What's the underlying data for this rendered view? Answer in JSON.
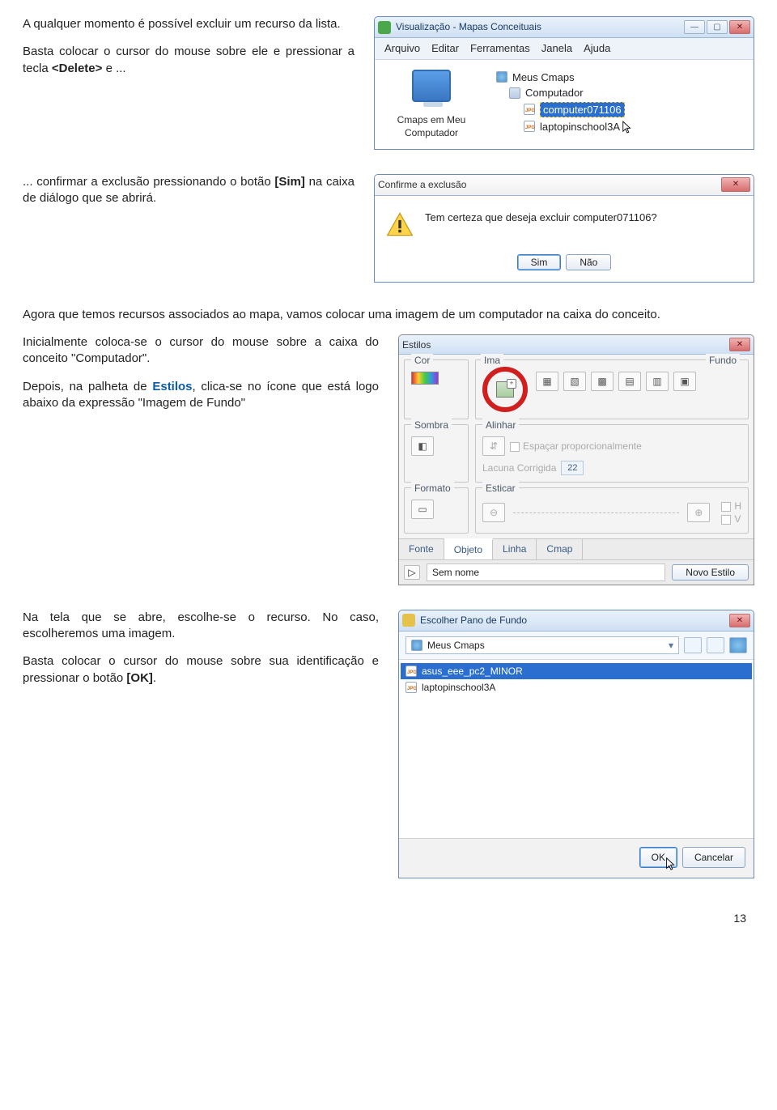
{
  "para1a": "A qualquer momento é possível excluir um recurso da lista.",
  "para1b_pre": "Basta colocar o cursor do mouse sobre ele e pressionar a tecla ",
  "para1b_key": "<Delete>",
  "para1b_post": " e ...",
  "para2_pre": "... confirmar a exclusão pressionando o botão ",
  "para2_btn": "[Sim]",
  "para2_post": " na caixa de diálogo que se abrirá.",
  "para3": "Agora que temos recursos associados ao mapa, vamos colocar uma imagem de um computador na caixa do conceito.",
  "para4": "Inicialmente coloca-se o cursor do mouse sobre a caixa do conceito \"Computador\".",
  "para5_pre": "Depois, na palheta de ",
  "para5_est": "Estilos",
  "para5_post": ", clica-se no ícone que está logo abaixo da expressão \"Imagem de Fundo\"",
  "para6": "Na tela que se abre, escolhe-se o recurso.  No caso, escolheremos uma imagem.",
  "para7_pre": "Basta colocar o cursor do mouse sobre sua identificação  e pressionar o botão ",
  "para7_btn": "[OK]",
  "para7_post": ".",
  "fig1": {
    "title": "Visualização - Mapas Conceituais",
    "menus": [
      "Arquivo",
      "Editar",
      "Ferramentas",
      "Janela",
      "Ajuda"
    ],
    "desktop_label": "Cmaps em Meu Computador",
    "tree": {
      "root": "Meus Cmaps",
      "n1": "Computador",
      "n2": "computer071106",
      "n3": "laptopinschool3A"
    }
  },
  "fig2": {
    "title": "Confirme a exclusão",
    "msg": "Tem certeza que deseja excluir computer071106?",
    "yes": "Sim",
    "no": "Não"
  },
  "fig3": {
    "title": "Estilos",
    "groups": {
      "cor": "Cor",
      "imagem": "Imagem de Fundo",
      "fundo_word": "Fundo",
      "sombra": "Sombra",
      "alinhar": "Alinhar",
      "espacar": "Espaçar proporcionalmente",
      "lacuna": "Lacuna Corrigida",
      "lacuna_val": "22",
      "formato": "Formato",
      "esticar": "Esticar",
      "h": "H",
      "v": "V"
    },
    "tabs": [
      "Fonte",
      "Objeto",
      "Linha",
      "Cmap"
    ],
    "active_tab": "Objeto",
    "footer_left": "Sem nome",
    "footer_btn": "Novo Estilo"
  },
  "fig4": {
    "title": "Escolher Pano de Fundo",
    "combo": "Meus Cmaps",
    "files": [
      {
        "name": "asus_eee_pc2_MINOR",
        "sel": true
      },
      {
        "name": "laptopinschool3A",
        "sel": false
      }
    ],
    "ok": "OK",
    "cancel": "Cancelar"
  },
  "page_num": "13"
}
